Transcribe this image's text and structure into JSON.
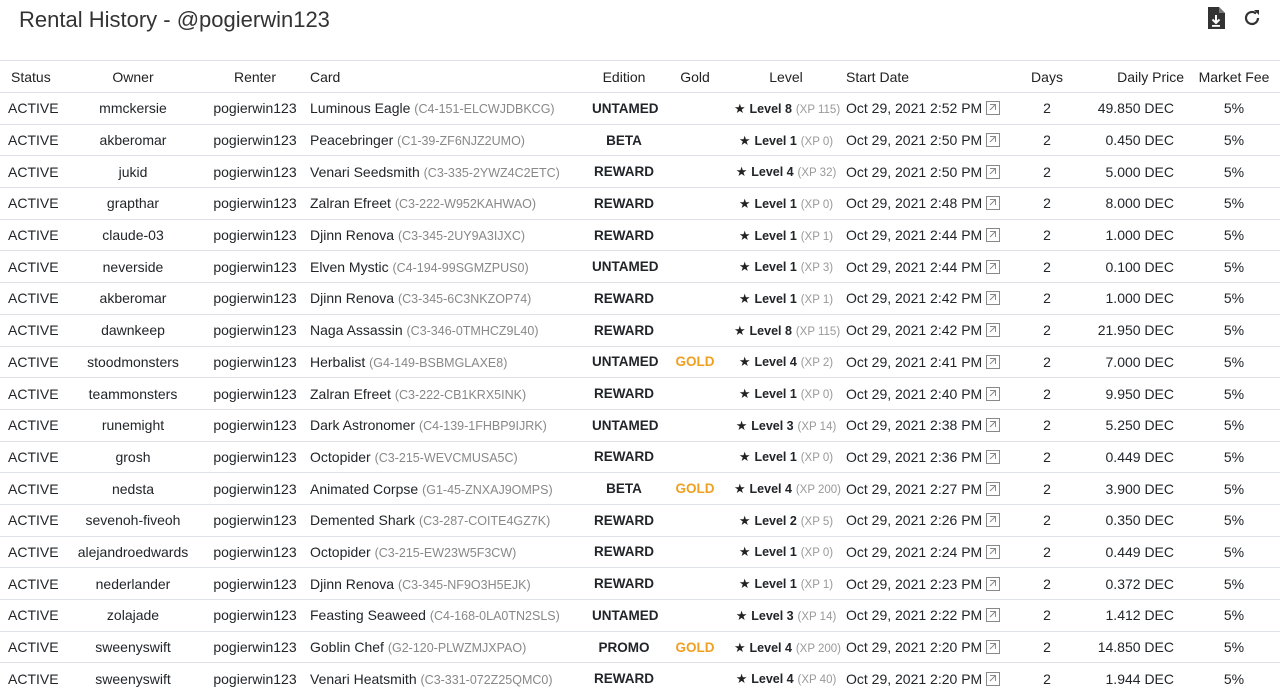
{
  "page": {
    "title": "Rental History - @pogierwin123"
  },
  "icons": {
    "download": "download-file-icon",
    "refresh": "refresh-icon",
    "star": "star-icon",
    "external": "external-link-icon"
  },
  "colors": {
    "gold": "#f0a020"
  },
  "table": {
    "headers": [
      "Status",
      "Owner",
      "Renter",
      "Card",
      "Edition",
      "Gold",
      "Level",
      "Start Date",
      "Days",
      "Daily Price",
      "Market Fee"
    ],
    "rows": [
      {
        "status": "ACTIVE",
        "owner": "mmckersie",
        "renter": "pogierwin123",
        "card": "Luminous Eagle",
        "uid": "(C4-151-ELCWJDBKCG)",
        "edition": "UNTAMED",
        "gold": "",
        "level": "Level 8",
        "xp": "(XP 115)",
        "start": "Oct 29, 2021 2:52 PM",
        "days": "2",
        "price": "49.850 DEC",
        "fee": "5%"
      },
      {
        "status": "ACTIVE",
        "owner": "akberomar",
        "renter": "pogierwin123",
        "card": "Peacebringer",
        "uid": "(C1-39-ZF6NJZ2UMO)",
        "edition": "BETA",
        "gold": "",
        "level": "Level 1",
        "xp": "(XP 0)",
        "start": "Oct 29, 2021 2:50 PM",
        "days": "2",
        "price": "0.450 DEC",
        "fee": "5%"
      },
      {
        "status": "ACTIVE",
        "owner": "jukid",
        "renter": "pogierwin123",
        "card": "Venari Seedsmith",
        "uid": "(C3-335-2YWZ4C2ETC)",
        "edition": "REWARD",
        "gold": "",
        "level": "Level 4",
        "xp": "(XP 32)",
        "start": "Oct 29, 2021 2:50 PM",
        "days": "2",
        "price": "5.000 DEC",
        "fee": "5%"
      },
      {
        "status": "ACTIVE",
        "owner": "grapthar",
        "renter": "pogierwin123",
        "card": "Zalran Efreet",
        "uid": "(C3-222-W952KAHWAO)",
        "edition": "REWARD",
        "gold": "",
        "level": "Level 1",
        "xp": "(XP 0)",
        "start": "Oct 29, 2021 2:48 PM",
        "days": "2",
        "price": "8.000 DEC",
        "fee": "5%"
      },
      {
        "status": "ACTIVE",
        "owner": "claude-03",
        "renter": "pogierwin123",
        "card": "Djinn Renova",
        "uid": "(C3-345-2UY9A3IJXC)",
        "edition": "REWARD",
        "gold": "",
        "level": "Level 1",
        "xp": "(XP 1)",
        "start": "Oct 29, 2021 2:44 PM",
        "days": "2",
        "price": "1.000 DEC",
        "fee": "5%"
      },
      {
        "status": "ACTIVE",
        "owner": "neverside",
        "renter": "pogierwin123",
        "card": "Elven Mystic",
        "uid": "(C4-194-99SGMZPUS0)",
        "edition": "UNTAMED",
        "gold": "",
        "level": "Level 1",
        "xp": "(XP 3)",
        "start": "Oct 29, 2021 2:44 PM",
        "days": "2",
        "price": "0.100 DEC",
        "fee": "5%"
      },
      {
        "status": "ACTIVE",
        "owner": "akberomar",
        "renter": "pogierwin123",
        "card": "Djinn Renova",
        "uid": "(C3-345-6C3NKZOP74)",
        "edition": "REWARD",
        "gold": "",
        "level": "Level 1",
        "xp": "(XP 1)",
        "start": "Oct 29, 2021 2:42 PM",
        "days": "2",
        "price": "1.000 DEC",
        "fee": "5%"
      },
      {
        "status": "ACTIVE",
        "owner": "dawnkeep",
        "renter": "pogierwin123",
        "card": "Naga Assassin",
        "uid": "(C3-346-0TMHCZ9L40)",
        "edition": "REWARD",
        "gold": "",
        "level": "Level 8",
        "xp": "(XP 115)",
        "start": "Oct 29, 2021 2:42 PM",
        "days": "2",
        "price": "21.950 DEC",
        "fee": "5%"
      },
      {
        "status": "ACTIVE",
        "owner": "stoodmonsters",
        "renter": "pogierwin123",
        "card": "Herbalist",
        "uid": "(G4-149-BSBMGLAXE8)",
        "edition": "UNTAMED",
        "gold": "GOLD",
        "level": "Level 4",
        "xp": "(XP 2)",
        "start": "Oct 29, 2021 2:41 PM",
        "days": "2",
        "price": "7.000 DEC",
        "fee": "5%"
      },
      {
        "status": "ACTIVE",
        "owner": "teammonsters",
        "renter": "pogierwin123",
        "card": "Zalran Efreet",
        "uid": "(C3-222-CB1KRX5INK)",
        "edition": "REWARD",
        "gold": "",
        "level": "Level 1",
        "xp": "(XP 0)",
        "start": "Oct 29, 2021 2:40 PM",
        "days": "2",
        "price": "9.950 DEC",
        "fee": "5%"
      },
      {
        "status": "ACTIVE",
        "owner": "runemight",
        "renter": "pogierwin123",
        "card": "Dark Astronomer",
        "uid": "(C4-139-1FHBP9IJRK)",
        "edition": "UNTAMED",
        "gold": "",
        "level": "Level 3",
        "xp": "(XP 14)",
        "start": "Oct 29, 2021 2:38 PM",
        "days": "2",
        "price": "5.250 DEC",
        "fee": "5%"
      },
      {
        "status": "ACTIVE",
        "owner": "grosh",
        "renter": "pogierwin123",
        "card": "Octopider",
        "uid": "(C3-215-WEVCMUSA5C)",
        "edition": "REWARD",
        "gold": "",
        "level": "Level 1",
        "xp": "(XP 0)",
        "start": "Oct 29, 2021 2:36 PM",
        "days": "2",
        "price": "0.449 DEC",
        "fee": "5%"
      },
      {
        "status": "ACTIVE",
        "owner": "nedsta",
        "renter": "pogierwin123",
        "card": "Animated Corpse",
        "uid": "(G1-45-ZNXAJ9OMPS)",
        "edition": "BETA",
        "gold": "GOLD",
        "level": "Level 4",
        "xp": "(XP 200)",
        "start": "Oct 29, 2021 2:27 PM",
        "days": "2",
        "price": "3.900 DEC",
        "fee": "5%"
      },
      {
        "status": "ACTIVE",
        "owner": "sevenoh-fiveoh",
        "renter": "pogierwin123",
        "card": "Demented Shark",
        "uid": "(C3-287-COITE4GZ7K)",
        "edition": "REWARD",
        "gold": "",
        "level": "Level 2",
        "xp": "(XP 5)",
        "start": "Oct 29, 2021 2:26 PM",
        "days": "2",
        "price": "0.350 DEC",
        "fee": "5%"
      },
      {
        "status": "ACTIVE",
        "owner": "alejandroedwards",
        "renter": "pogierwin123",
        "card": "Octopider",
        "uid": "(C3-215-EW23W5F3CW)",
        "edition": "REWARD",
        "gold": "",
        "level": "Level 1",
        "xp": "(XP 0)",
        "start": "Oct 29, 2021 2:24 PM",
        "days": "2",
        "price": "0.449 DEC",
        "fee": "5%"
      },
      {
        "status": "ACTIVE",
        "owner": "nederlander",
        "renter": "pogierwin123",
        "card": "Djinn Renova",
        "uid": "(C3-345-NF9O3H5EJK)",
        "edition": "REWARD",
        "gold": "",
        "level": "Level 1",
        "xp": "(XP 1)",
        "start": "Oct 29, 2021 2:23 PM",
        "days": "2",
        "price": "0.372 DEC",
        "fee": "5%"
      },
      {
        "status": "ACTIVE",
        "owner": "zolajade",
        "renter": "pogierwin123",
        "card": "Feasting Seaweed",
        "uid": "(C4-168-0LA0TN2SLS)",
        "edition": "UNTAMED",
        "gold": "",
        "level": "Level 3",
        "xp": "(XP 14)",
        "start": "Oct 29, 2021 2:22 PM",
        "days": "2",
        "price": "1.412 DEC",
        "fee": "5%"
      },
      {
        "status": "ACTIVE",
        "owner": "sweenyswift",
        "renter": "pogierwin123",
        "card": "Goblin Chef",
        "uid": "(G2-120-PLWZMJXPAO)",
        "edition": "PROMO",
        "gold": "GOLD",
        "level": "Level 4",
        "xp": "(XP 200)",
        "start": "Oct 29, 2021 2:20 PM",
        "days": "2",
        "price": "14.850 DEC",
        "fee": "5%"
      },
      {
        "status": "ACTIVE",
        "owner": "sweenyswift",
        "renter": "pogierwin123",
        "card": "Venari Heatsmith",
        "uid": "(C3-331-072Z25QMC0)",
        "edition": "REWARD",
        "gold": "",
        "level": "Level 4",
        "xp": "(XP 40)",
        "start": "Oct 29, 2021 2:20 PM",
        "days": "2",
        "price": "1.944 DEC",
        "fee": "5%"
      }
    ]
  }
}
